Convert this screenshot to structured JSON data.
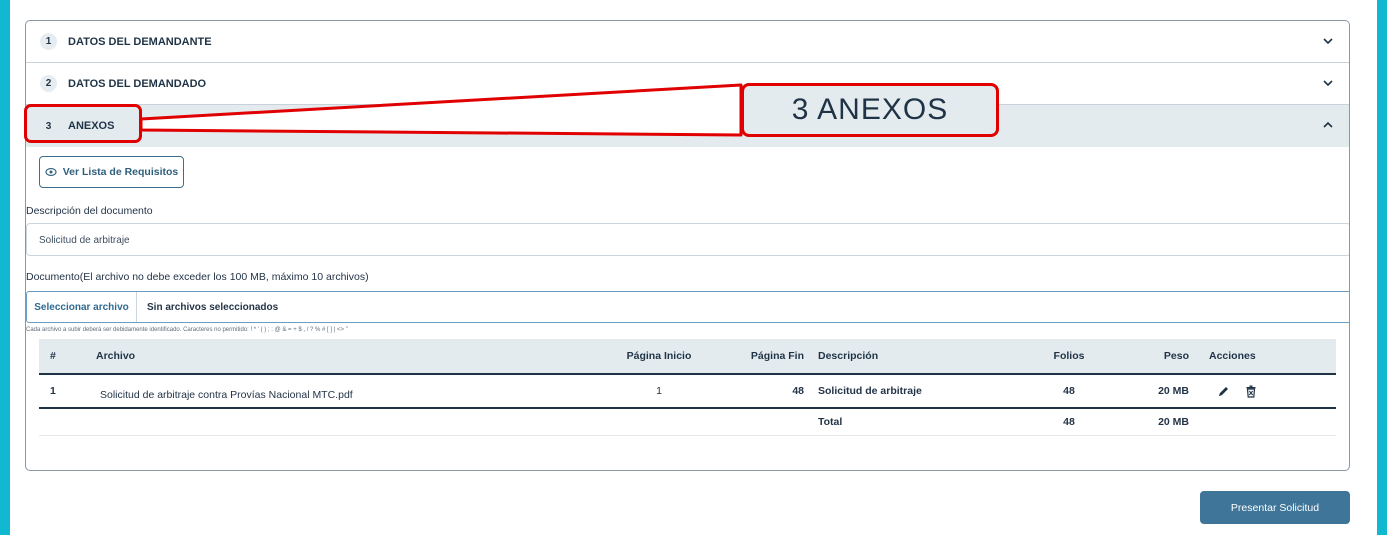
{
  "sections": [
    {
      "number": "1",
      "title": "DATOS DEL DEMANDANTE"
    },
    {
      "number": "2",
      "title": "DATOS DEL DEMANDADO"
    },
    {
      "number": "3",
      "title": "ANEXOS"
    }
  ],
  "callout": {
    "label": "3  ANEXOS"
  },
  "anexos": {
    "requirements_button": "Ver Lista de Requisitos",
    "description_label": "Descripción del documento",
    "description_value": "Solicitud de arbitraje",
    "document_label": "Documento(El archivo no debe exceder los 100 MB, máximo 10 archivos)",
    "file_button": "Seleccionar archivo",
    "file_status": "Sin archivos seleccionados",
    "hint": "Cada archivo a subir deberá ser debidamente identificado. Caracteres no permitido: ! * ' ( ) ; : @ & = + $ , / ? % # [ ] | <> \""
  },
  "table": {
    "headers": [
      "#",
      "Archivo",
      "Página Inicio",
      "Página Fin",
      "Descripción",
      "Folios",
      "Peso",
      "Acciones"
    ],
    "rows": [
      {
        "num": "1",
        "file": "Solicitud de arbitraje contra Provías Nacional MTC.pdf",
        "page_start": "1",
        "page_end": "48",
        "description": "Solicitud de arbitraje",
        "folios": "48",
        "size": "20 MB"
      }
    ],
    "total": {
      "label": "Total",
      "folios": "48",
      "size": "20 MB"
    }
  },
  "submit_button": "Presentar Solicitud",
  "colors": {
    "frame": "#10b8d0",
    "accent": "#3e7598",
    "callout": "#e00000",
    "header_bg": "#e4ebef"
  }
}
